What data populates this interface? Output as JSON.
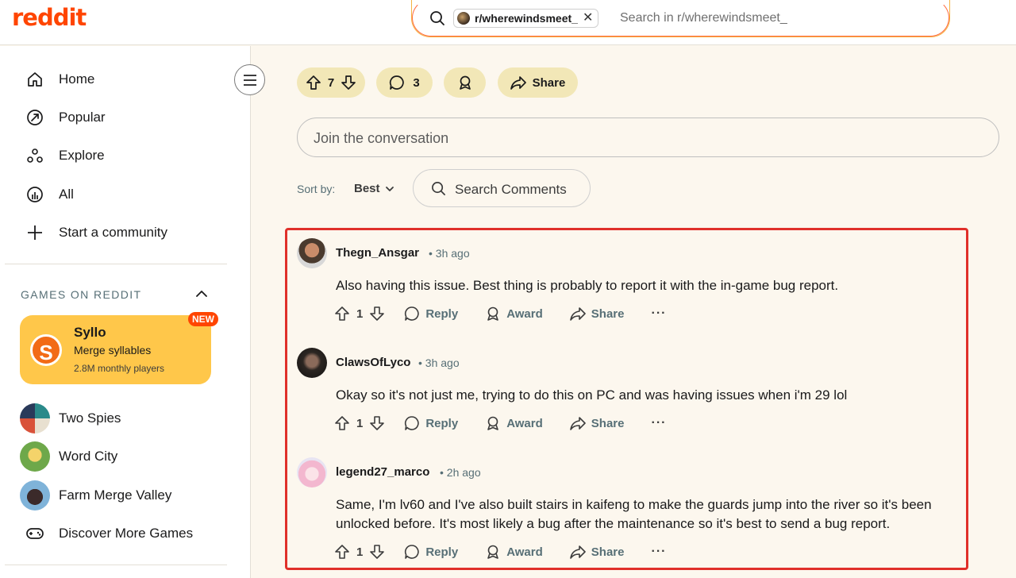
{
  "header": {
    "logo": "reddit",
    "search_chip": "r/wherewindsmeet_",
    "search_placeholder": "Search in r/wherewindsmeet_"
  },
  "sidebar": {
    "nav": [
      {
        "label": "Home",
        "icon": "home-icon"
      },
      {
        "label": "Popular",
        "icon": "popular-icon"
      },
      {
        "label": "Explore",
        "icon": "explore-icon"
      },
      {
        "label": "All",
        "icon": "all-icon"
      },
      {
        "label": "Start a community",
        "icon": "plus-icon"
      }
    ],
    "games_section_title": "GAMES ON REDDIT",
    "promo": {
      "title": "Syllo",
      "subtitle": "Merge syllables",
      "players": "2.8M monthly players",
      "badge": "NEW",
      "logo_letter": "S"
    },
    "games": [
      {
        "label": "Two Spies"
      },
      {
        "label": "Word City"
      },
      {
        "label": "Farm Merge Valley"
      },
      {
        "label": "Discover More Games"
      }
    ]
  },
  "post_actions": {
    "votes": "7",
    "comments": "3",
    "share": "Share"
  },
  "join_placeholder": "Join the conversation",
  "sort": {
    "label": "Sort by:",
    "value": "Best"
  },
  "comment_search_placeholder": "Search Comments",
  "comments": [
    {
      "user": "Thegn_Ansgar",
      "time": "• 3h ago",
      "body": "Also having this issue. Best thing is probably to report it with the in-game bug report.",
      "votes": "1",
      "reply": "Reply",
      "award": "Award",
      "share": "Share",
      "more": "···"
    },
    {
      "user": "ClawsOfLyco",
      "time": "• 3h ago",
      "body": "Okay so it's not just me, trying to do this on PC and was having issues when i'm 29 lol",
      "votes": "1",
      "reply": "Reply",
      "award": "Award",
      "share": "Share",
      "more": "···"
    },
    {
      "user": "legend27_marco",
      "time": "• 2h ago",
      "body": "Same, I'm lv60 and I've also built stairs in kaifeng to make the guards jump into the river so it's been unlocked before. It's most likely a bug after the maintenance so it's best to send a bug report.",
      "votes": "1",
      "reply": "Reply",
      "award": "Award",
      "share": "Share",
      "more": "···"
    }
  ],
  "colors": {
    "brand": "#ff4500",
    "page_bg": "#fcf7ee",
    "pill_bg": "#f2e7b7",
    "promo_bg": "#ffc74a",
    "highlight": "#e0302a"
  }
}
